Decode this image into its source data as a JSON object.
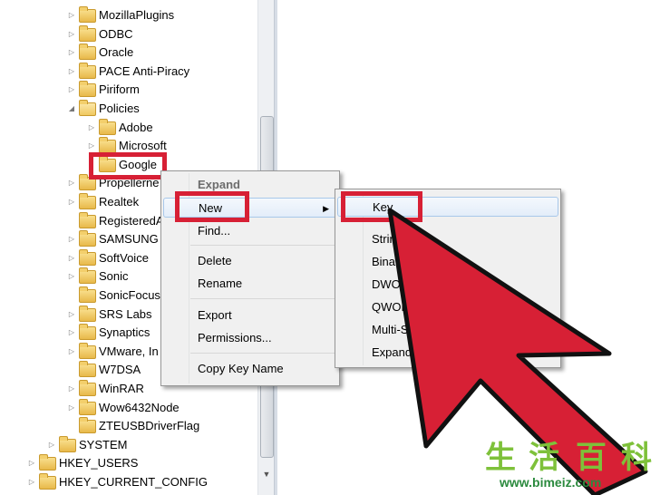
{
  "tree": {
    "items": [
      {
        "label": "MozillaPlugins",
        "toggle": "▷",
        "level": 2,
        "open": false
      },
      {
        "label": "ODBC",
        "toggle": "▷",
        "level": 2,
        "open": false
      },
      {
        "label": "Oracle",
        "toggle": "▷",
        "level": 2,
        "open": false
      },
      {
        "label": "PACE Anti-Piracy",
        "toggle": "▷",
        "level": 2,
        "open": false
      },
      {
        "label": "Piriform",
        "toggle": "▷",
        "level": 2,
        "open": false
      },
      {
        "label": "Policies",
        "toggle": "◢",
        "level": 2,
        "open": true
      },
      {
        "label": "Adobe",
        "toggle": "▷",
        "level": 3,
        "open": false
      },
      {
        "label": "Microsoft",
        "toggle": "▷",
        "level": 3,
        "open": false
      },
      {
        "label": "Google",
        "toggle": "",
        "level": 3,
        "open": false
      },
      {
        "label": "Propellerne",
        "toggle": "▷",
        "level": 2,
        "open": false
      },
      {
        "label": "Realtek",
        "toggle": "▷",
        "level": 2,
        "open": false
      },
      {
        "label": "RegisteredA",
        "toggle": "",
        "level": 2,
        "open": false
      },
      {
        "label": "SAMSUNG",
        "toggle": "▷",
        "level": 2,
        "open": false
      },
      {
        "label": "SoftVoice",
        "toggle": "▷",
        "level": 2,
        "open": false
      },
      {
        "label": "Sonic",
        "toggle": "▷",
        "level": 2,
        "open": false
      },
      {
        "label": "SonicFocus",
        "toggle": "",
        "level": 2,
        "open": false
      },
      {
        "label": "SRS Labs",
        "toggle": "▷",
        "level": 2,
        "open": false
      },
      {
        "label": "Synaptics",
        "toggle": "▷",
        "level": 2,
        "open": false
      },
      {
        "label": "VMware, In",
        "toggle": "▷",
        "level": 2,
        "open": false
      },
      {
        "label": "W7DSA",
        "toggle": "",
        "level": 2,
        "open": false
      },
      {
        "label": "WinRAR",
        "toggle": "▷",
        "level": 2,
        "open": false
      },
      {
        "label": "Wow6432Node",
        "toggle": "▷",
        "level": 2,
        "open": false
      },
      {
        "label": "ZTEUSBDriverFlag",
        "toggle": "",
        "level": 2,
        "open": false
      },
      {
        "label": "SYSTEM",
        "toggle": "▷",
        "level": 1,
        "open": false
      },
      {
        "label": "HKEY_USERS",
        "toggle": "▷",
        "level": 0,
        "open": false
      },
      {
        "label": "HKEY_CURRENT_CONFIG",
        "toggle": "▷",
        "level": 0,
        "open": false
      }
    ]
  },
  "context_menu": {
    "expand": "Expand",
    "new": "New",
    "new_arrow": "▶",
    "find": "Find...",
    "delete": "Delete",
    "rename": "Rename",
    "export": "Export",
    "permissions": "Permissions...",
    "copy_key_name": "Copy Key Name"
  },
  "sub_menu": {
    "key": "Key",
    "string_value": "String Value",
    "binary_value": "Binary Value",
    "dword_value": "DWORD (32-bit) Value",
    "qword_value": "QWORD (64-bit) Value",
    "multi_string_value": "Multi-String Value",
    "expandable_string_value": "Expandable String Value"
  },
  "watermark": {
    "chars": [
      "生",
      "活",
      "百",
      "科"
    ],
    "url": "www.bimeiz.com"
  },
  "colors": {
    "highlight_red": "#d72035",
    "watermark_green": "#7ec13a"
  }
}
